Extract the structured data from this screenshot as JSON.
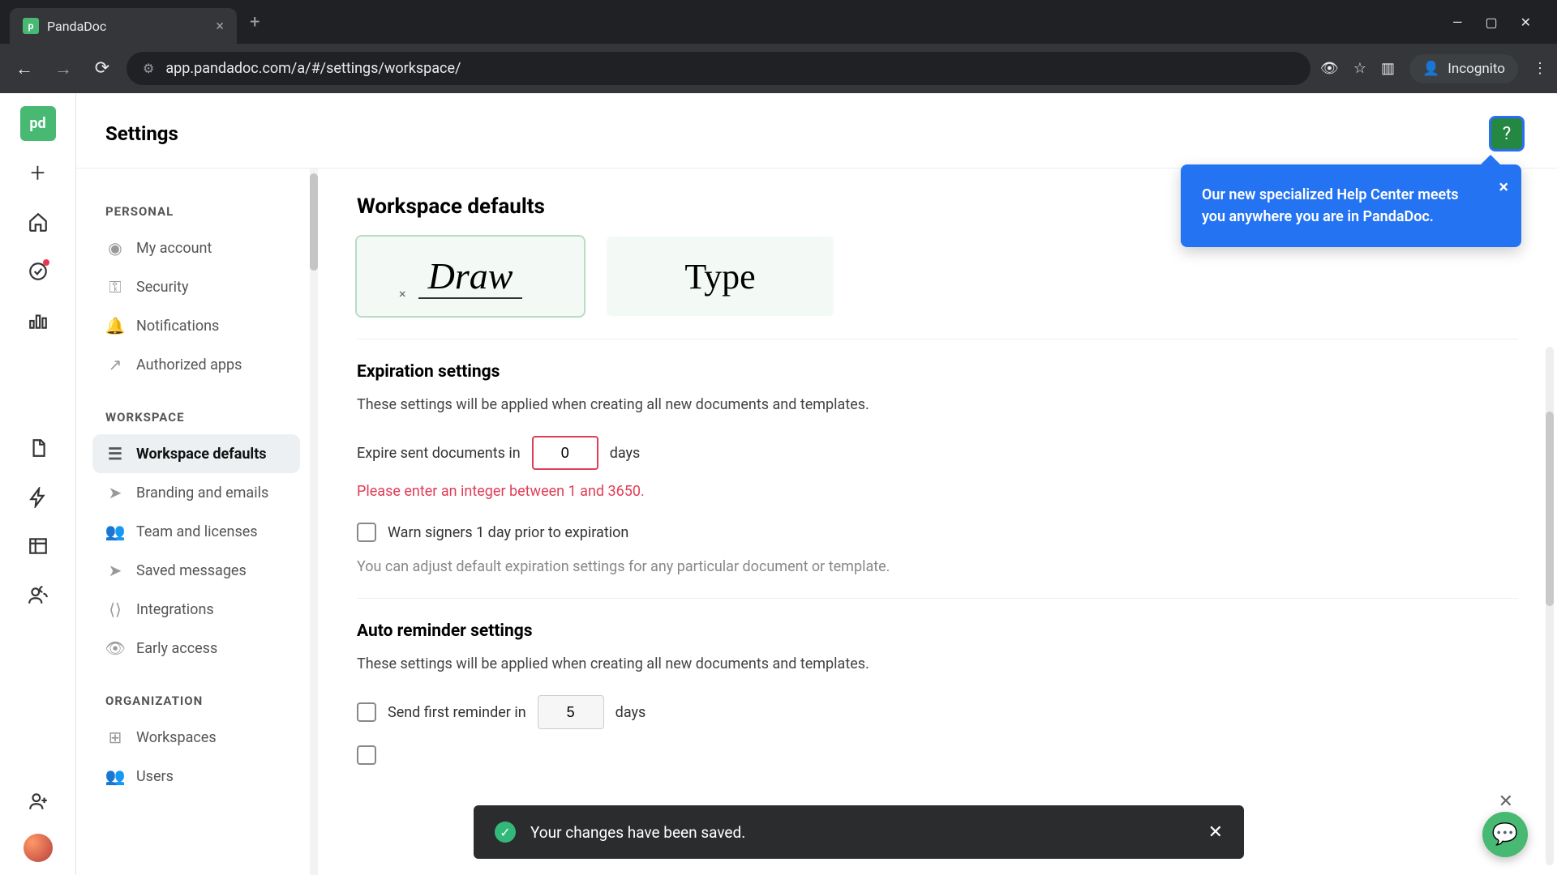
{
  "browser": {
    "tab_title": "PandaDoc",
    "url": "app.pandadoc.com/a/#/settings/workspace/",
    "incognito_label": "Incognito"
  },
  "page_title": "Settings",
  "nav": {
    "personal": {
      "title": "PERSONAL",
      "items": [
        "My account",
        "Security",
        "Notifications",
        "Authorized apps"
      ]
    },
    "workspace": {
      "title": "WORKSPACE",
      "items": [
        "Workspace defaults",
        "Branding and emails",
        "Team and licenses",
        "Saved messages",
        "Integrations",
        "Early access"
      ]
    },
    "organization": {
      "title": "ORGANIZATION",
      "items": [
        "Workspaces",
        "Users"
      ]
    }
  },
  "content": {
    "main_title": "Workspace defaults",
    "signature": {
      "draw": "Draw",
      "type": "Type",
      "remove": "×"
    },
    "expiration": {
      "title": "Expiration settings",
      "desc": "These settings will be applied when creating all new documents and templates.",
      "label_before": "Expire sent documents in",
      "value": "0",
      "label_after": "days",
      "error": "Please enter an integer between 1 and 3650.",
      "warn": "Warn signers 1 day prior to expiration",
      "hint": "You can adjust default expiration settings for any particular document or template."
    },
    "reminder": {
      "title": "Auto reminder settings",
      "desc": "These settings will be applied when creating all new documents and templates.",
      "first_label_before": "Send first reminder in",
      "first_value": "5",
      "first_label_after": "days"
    }
  },
  "popover": "Our new specialized Help Center meets you anywhere you are in PandaDoc.",
  "toast": "Your changes have been saved."
}
